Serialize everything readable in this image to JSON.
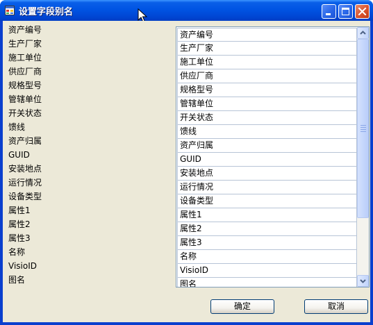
{
  "window": {
    "title": "设置字段别名",
    "icon": "app-window-icon",
    "controls": [
      "minimize-icon",
      "maximize-icon",
      "close-icon"
    ]
  },
  "labels": [
    "资产编号",
    "生产厂家",
    "施工单位",
    "供应厂商",
    "规格型号",
    "管辖单位",
    "开关状态",
    "馈线",
    "资产归属",
    "GUID",
    "安装地点",
    "运行情况",
    "设备类型",
    "属性1",
    "属性2",
    "属性3",
    "名称",
    "VisioID",
    "图名"
  ],
  "fields": [
    "资产编号",
    "生产厂家",
    "施工单位",
    "供应厂商",
    "规格型号",
    "管辖单位",
    "开关状态",
    "馈线",
    "资产归属",
    "GUID",
    "安装地点",
    "运行情况",
    "设备类型",
    "属性1",
    "属性2",
    "属性3",
    "名称",
    "VisioID",
    "图名"
  ],
  "buttons": {
    "ok": "确定",
    "cancel": "取消"
  },
  "colors": {
    "titlebar": "#0054e3",
    "client_bg": "#ece9d8",
    "close_button": "#d9532e"
  }
}
